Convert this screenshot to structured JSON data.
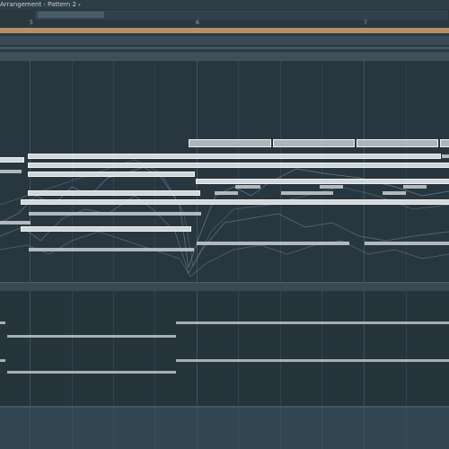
{
  "breadcrumb": {
    "items": [
      "Arrangement",
      "Pattern 2"
    ],
    "separator": "›",
    "trailing_icon": "dropdown-arrow-icon"
  },
  "timeline": {
    "bar_numbers": [
      "5",
      "6",
      "7"
    ]
  },
  "colors": {
    "background": "#28363f",
    "loop_strip": "#b98f66",
    "note": "#dfe4e8",
    "automation": "#9fb3bf",
    "bottom_panel": "#314650"
  }
}
